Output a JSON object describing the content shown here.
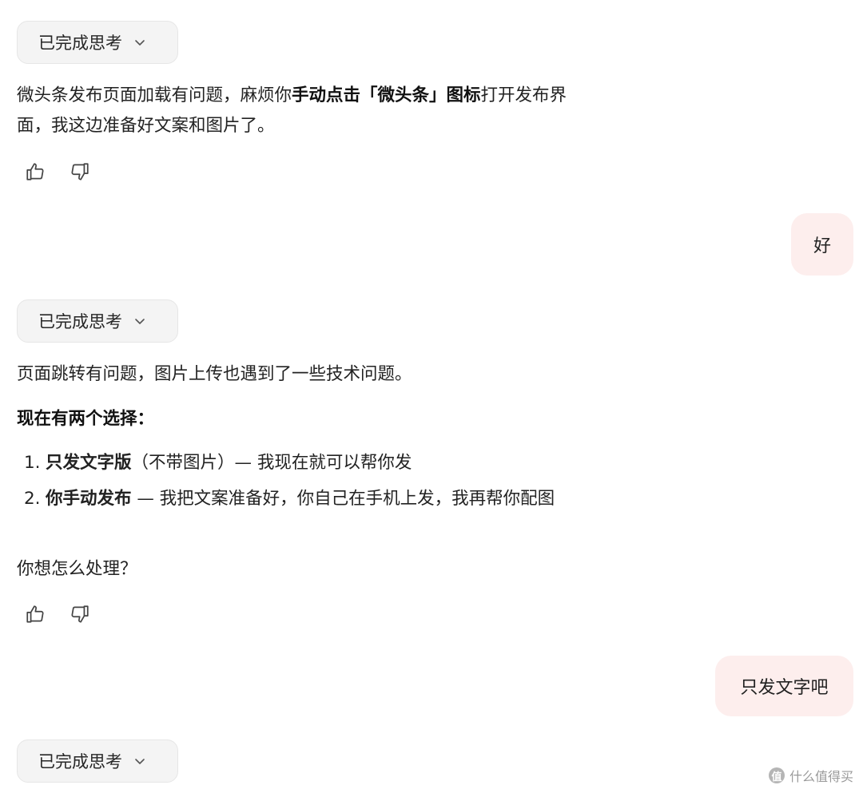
{
  "conversation": {
    "thinking_label": "已完成思考",
    "msg1": {
      "p1_a": "微头条发布页面加载有问题，麻烦你",
      "p1_b": "手动点击「微头条」图标",
      "p1_c": "打开发布界面，我这边准备好文案和图片了。"
    },
    "user1": "好",
    "msg2": {
      "p1": "页面跳转有问题，图片上传也遇到了一些技术问题。",
      "p2": "现在有两个选择：",
      "choices": [
        {
          "num": "1.",
          "bold": "只发文字版",
          "rest": "（不带图片）— 我现在就可以帮你发"
        },
        {
          "num": "2.",
          "bold": "你手动发布",
          "rest": " — 我把文案准备好，你自己在手机上发，我再帮你配图"
        }
      ],
      "p3": "你想怎么处理？"
    },
    "user2": "只发文字吧"
  },
  "watermark": {
    "icon_text": "值",
    "text": "什么值得买"
  }
}
